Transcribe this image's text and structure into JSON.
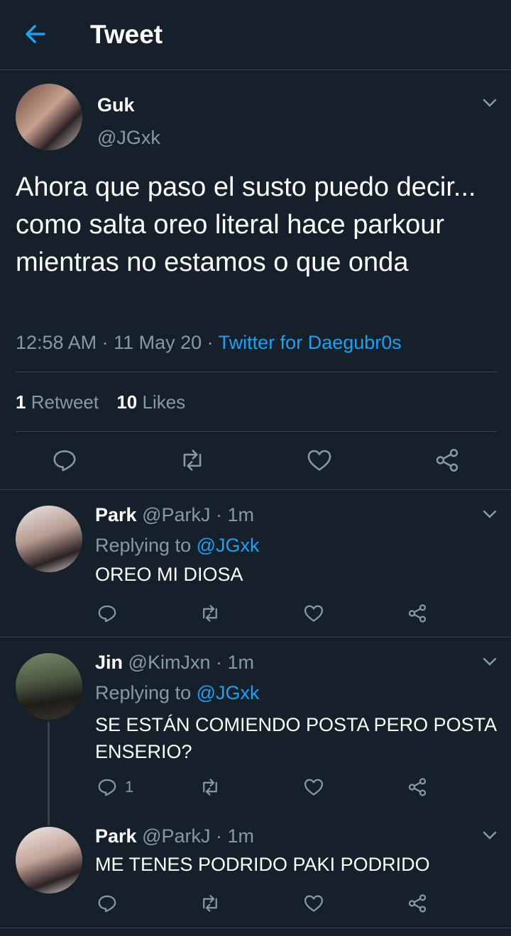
{
  "header": {
    "title": "Tweet"
  },
  "main_tweet": {
    "name": "Guk",
    "handle": "@JGxk",
    "text": "Ahora que paso el susto puedo decir... como salta oreo literal hace parkour mientras no estamos o que onda",
    "time": "12:58 AM",
    "date": "11 May 20",
    "source": "Twitter for Daegubr0s",
    "retweets_count": "1",
    "retweets_label": "Retweet",
    "likes_count": "10",
    "likes_label": "Likes"
  },
  "replies": [
    {
      "name": "Park",
      "handle": "@ParkJ",
      "time": "1m",
      "replying_prefix": "Replying to",
      "replying_to": "@JGxk",
      "text": "OREO MI DIOSA",
      "reply_count": ""
    },
    {
      "name": "Jin",
      "handle": "@KimJxn",
      "time": "1m",
      "replying_prefix": "Replying to",
      "replying_to": "@JGxk",
      "text": "SE ESTÁN COMIENDO POSTA PERO POSTA ENSERIO?",
      "reply_count": "1"
    },
    {
      "name": "Park",
      "handle": "@ParkJ",
      "time": "1m",
      "text": "ME TENES PODRIDO PAKI PODRIDO",
      "reply_count": ""
    }
  ],
  "colors": {
    "background": "#15202b",
    "accent": "#1da1f2",
    "muted": "#8899a6",
    "divider": "#38444d"
  },
  "icons": [
    "back-arrow-icon",
    "chevron-down-icon",
    "reply-icon",
    "retweet-icon",
    "like-icon",
    "share-icon"
  ]
}
